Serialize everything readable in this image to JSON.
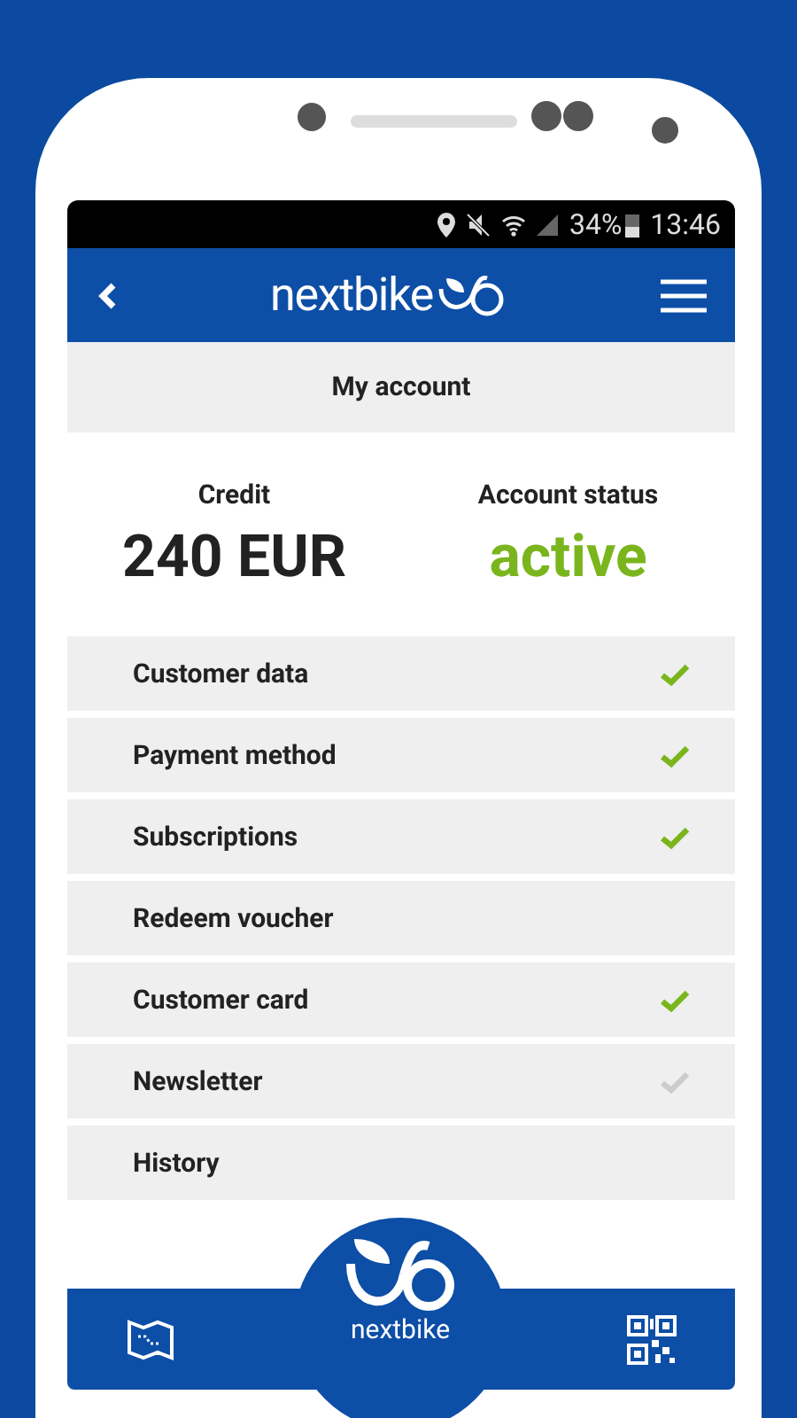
{
  "status_bar": {
    "battery": "34%",
    "time": "13:46"
  },
  "header": {
    "logo": "nextbike"
  },
  "page_title": "My account",
  "summary": [
    {
      "label": "Credit",
      "value": "240 EUR",
      "kind": "amount"
    },
    {
      "label": "Account status",
      "value": "active",
      "kind": "status"
    }
  ],
  "items": [
    {
      "label": "Customer data",
      "kind": "check",
      "checked": true
    },
    {
      "label": "Payment method",
      "kind": "check",
      "checked": true
    },
    {
      "label": "Subscriptions",
      "kind": "check",
      "checked": true
    },
    {
      "label": "Redeem voucher",
      "kind": "plain"
    },
    {
      "label": "Customer card",
      "kind": "check",
      "checked": true
    },
    {
      "label": "Newsletter",
      "kind": "check",
      "checked": false
    },
    {
      "label": "History",
      "kind": "plain"
    }
  ],
  "bottom_bar": {
    "logo": "nextbike"
  }
}
